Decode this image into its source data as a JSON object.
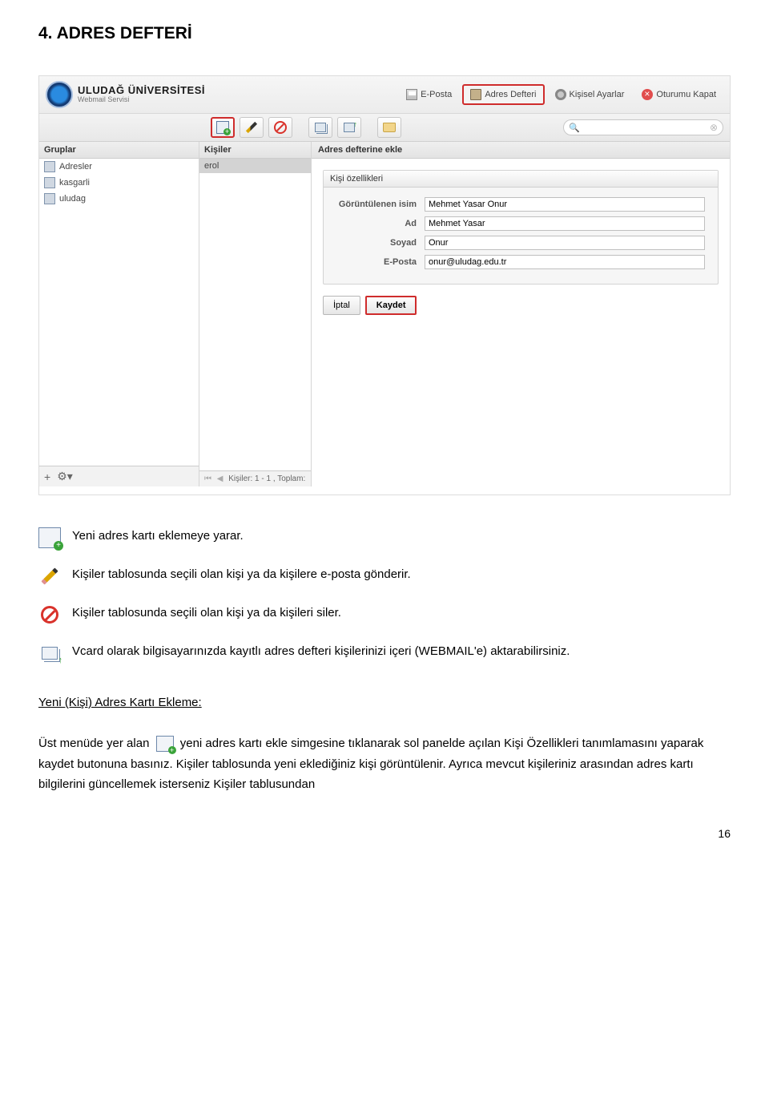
{
  "doc": {
    "heading": "4. ADRES DEFTERİ",
    "page_number": "16"
  },
  "screenshot": {
    "brand_title": "ULUDAĞ ÜNİVERSİTESİ",
    "brand_sub": "Webmail Servisi",
    "nav": {
      "eposta": "E-Posta",
      "adres": "Adres Defteri",
      "ayarlar": "Kişisel Ayarlar",
      "oturum": "Oturumu Kapat"
    },
    "cols": {
      "gruplar_hdr": "Gruplar",
      "kisiler_hdr": "Kişiler",
      "main_hdr": "Adres defterine ekle",
      "grp_items": {
        "adresler": "Adresler",
        "kasgarli": "kasgarli",
        "uludag": "uludag"
      },
      "kisi_item": "erol",
      "kisi_footer": "Kişiler: 1 - 1 , Toplam:"
    },
    "form": {
      "tab": "Kişi özellikleri",
      "labels": {
        "goruntulenen": "Görüntülenen isim",
        "ad": "Ad",
        "soyad": "Soyad",
        "eposta": "E-Posta"
      },
      "values": {
        "goruntulenen": "Mehmet Yasar Onur",
        "ad": "Mehmet Yasar",
        "soyad": "Onur",
        "eposta": "onur@uludag.edu.tr"
      },
      "btn_iptal": "İptal",
      "btn_kaydet": "Kaydet"
    }
  },
  "defs": {
    "d1": "Yeni adres kartı eklemeye yarar.",
    "d2": "Kişiler tablosunda seçili olan kişi ya da kişilere e-posta gönderir.",
    "d3": "Kişiler tablosunda seçili olan kişi ya da kişileri siler.",
    "d4": "Vcard olarak bilgisayarınızda kayıtlı adres defteri kişilerinizi içeri (WEBMAIL'e) aktarabilirsiniz."
  },
  "sub_heading": "Yeni (Kişi) Adres Kartı Ekleme:",
  "para": {
    "pre": "Üst menüde yer alan",
    "post": "yeni adres kartı ekle simgesine tıklanarak sol panelde açılan Kişi Özellikleri tanımlamasını yaparak  kaydet butonuna basınız. Kişiler tablosunda yeni eklediğiniz kişi görüntülenir. Ayrıca mevcut kişileriniz arasından adres kartı bilgilerini güncellemek isterseniz Kişiler tablusundan"
  }
}
